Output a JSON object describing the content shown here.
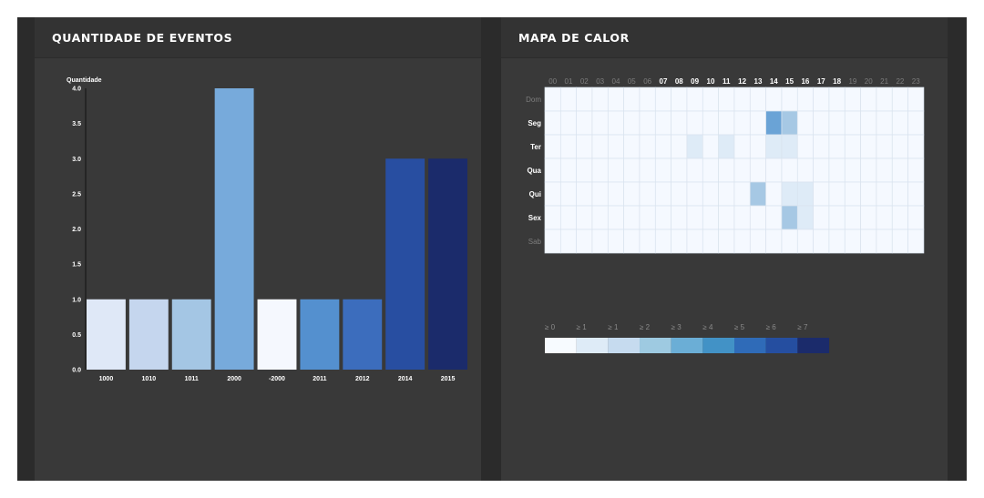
{
  "panels": {
    "left_title": "QUANTIDADE DE EVENTOS",
    "right_title": "MAPA DE CALOR"
  },
  "chart_data": [
    {
      "type": "bar",
      "title": "",
      "ylabel": "Quantidade",
      "xlabel": "",
      "categories": [
        "1000",
        "1010",
        "1011",
        "2000",
        "-2000",
        "2011",
        "2012",
        "2014",
        "2015"
      ],
      "values": [
        1,
        1,
        1,
        4,
        1,
        1,
        1,
        3,
        3
      ],
      "colors": [
        "#dfe8f7",
        "#c5d6ee",
        "#a4c6e4",
        "#77aadb",
        "#f5f8fe",
        "#5490cf",
        "#3c6dbd",
        "#284ea1",
        "#1b2b6b"
      ],
      "ylim": [
        0,
        4
      ],
      "yticks": [
        "0.0",
        "0.5",
        "1.0",
        "1.5",
        "2.0",
        "2.5",
        "3.0",
        "3.5",
        "4.0"
      ],
      "grid": false
    },
    {
      "type": "heatmap",
      "title": "",
      "x": [
        "00",
        "01",
        "02",
        "03",
        "04",
        "05",
        "06",
        "07",
        "08",
        "09",
        "10",
        "11",
        "12",
        "13",
        "14",
        "15",
        "16",
        "17",
        "18",
        "19",
        "20",
        "21",
        "22",
        "23"
      ],
      "x_active": [
        false,
        false,
        false,
        false,
        false,
        false,
        false,
        true,
        true,
        true,
        true,
        true,
        true,
        true,
        true,
        true,
        true,
        true,
        true,
        false,
        false,
        false,
        false,
        false
      ],
      "y": [
        "Dom",
        "Seg",
        "Ter",
        "Qua",
        "Qui",
        "Sex",
        "Sab"
      ],
      "y_active": [
        false,
        true,
        true,
        true,
        true,
        true,
        false
      ],
      "values": [
        [
          0,
          0,
          0,
          0,
          0,
          0,
          0,
          0,
          0,
          0,
          0,
          0,
          0,
          0,
          0,
          0,
          0,
          0,
          0,
          0,
          0,
          0,
          0,
          0
        ],
        [
          0,
          0,
          0,
          0,
          0,
          0,
          0,
          0,
          0,
          0,
          0,
          0,
          0,
          0,
          4,
          2,
          0,
          0,
          0,
          0,
          0,
          0,
          0,
          0
        ],
        [
          0,
          0,
          0,
          0,
          0,
          0,
          0,
          0,
          0,
          1,
          0,
          1,
          0,
          0,
          1,
          1,
          0,
          0,
          0,
          0,
          0,
          0,
          0,
          0
        ],
        [
          0,
          0,
          0,
          0,
          0,
          0,
          0,
          0,
          0,
          0,
          0,
          0,
          0,
          0,
          0,
          0,
          0,
          0,
          0,
          0,
          0,
          0,
          0,
          0
        ],
        [
          0,
          0,
          0,
          0,
          0,
          0,
          0,
          0,
          0,
          0,
          0,
          0,
          0,
          2,
          0,
          1,
          1,
          0,
          0,
          0,
          0,
          0,
          0,
          0
        ],
        [
          0,
          0,
          0,
          0,
          0,
          0,
          0,
          0,
          0,
          0,
          0,
          0,
          0,
          0,
          0,
          2,
          1,
          0,
          0,
          0,
          0,
          0,
          0,
          0
        ],
        [
          0,
          0,
          0,
          0,
          0,
          0,
          0,
          0,
          0,
          0,
          0,
          0,
          0,
          0,
          0,
          0,
          0,
          0,
          0,
          0,
          0,
          0,
          0,
          0
        ]
      ],
      "legend": {
        "labels": [
          "≥ 0",
          "≥ 1",
          "≥ 1",
          "≥ 2",
          "≥ 3",
          "≥ 4",
          "≥ 5",
          "≥ 6",
          "≥ 7"
        ],
        "colors": [
          "#f7fbff",
          "#deebf7",
          "#c6dbef",
          "#9ecae1",
          "#6baed6",
          "#4292c6",
          "#2f6bb8",
          "#254ea0",
          "#1b2b6b"
        ]
      },
      "colors": {
        "empty": "#f5f9ff",
        "grid": "#d9e3ee",
        "level_1": "#deebf7",
        "level_2": "#a6c8e4",
        "level_4": "#6aa3d6"
      }
    }
  ]
}
